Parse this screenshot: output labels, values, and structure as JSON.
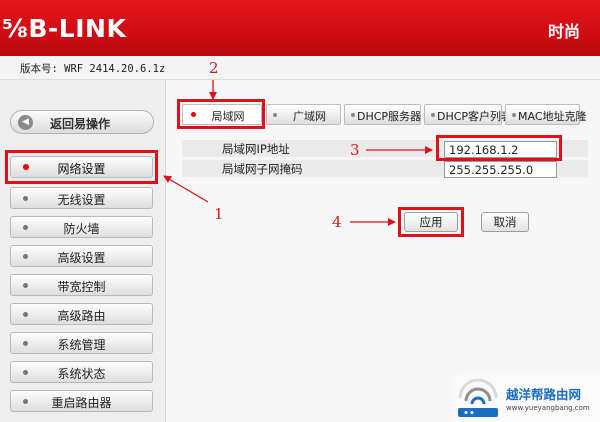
{
  "header": {
    "logo_text": "⅝B-LINK",
    "slogan_fragment": "时尚"
  },
  "version": {
    "text": "版本号: WRF 2414.20.6.1z"
  },
  "sidebar": {
    "back_label": "返回易操作",
    "items": [
      {
        "label": "网络设置",
        "active": true
      },
      {
        "label": "无线设置",
        "active": false
      },
      {
        "label": "防火墙",
        "active": false
      },
      {
        "label": "高级设置",
        "active": false
      },
      {
        "label": "带宽控制",
        "active": false
      },
      {
        "label": "高级路由",
        "active": false
      },
      {
        "label": "系统管理",
        "active": false
      },
      {
        "label": "系统状态",
        "active": false
      },
      {
        "label": "重启路由器",
        "active": false
      }
    ]
  },
  "tabs": [
    {
      "label": "局域网",
      "active": true
    },
    {
      "label": "广域网",
      "active": false
    },
    {
      "label": "DHCP服务器",
      "active": false
    },
    {
      "label": "DHCP客户列表",
      "active": false
    },
    {
      "label": "MAC地址克隆",
      "active": false
    }
  ],
  "form": {
    "ip_label": "局域网IP地址",
    "ip_value": "192.168.1.2",
    "mask_label": "局域网子网掩码",
    "mask_value": "255.255.255.0"
  },
  "buttons": {
    "apply": "应用",
    "cancel": "取消"
  },
  "annotations": {
    "n1": "1",
    "n2": "2",
    "n3": "3",
    "n4": "4",
    "color": "#e0101a"
  },
  "watermark": {
    "title": "越洋帮路由网",
    "url": "www.yueyangbang.com",
    "icon": "wifi-router-icon"
  },
  "colors": {
    "header_red": "#d10e14",
    "highlight_red": "#e0101a",
    "watermark_blue": "#1a6fc2"
  }
}
